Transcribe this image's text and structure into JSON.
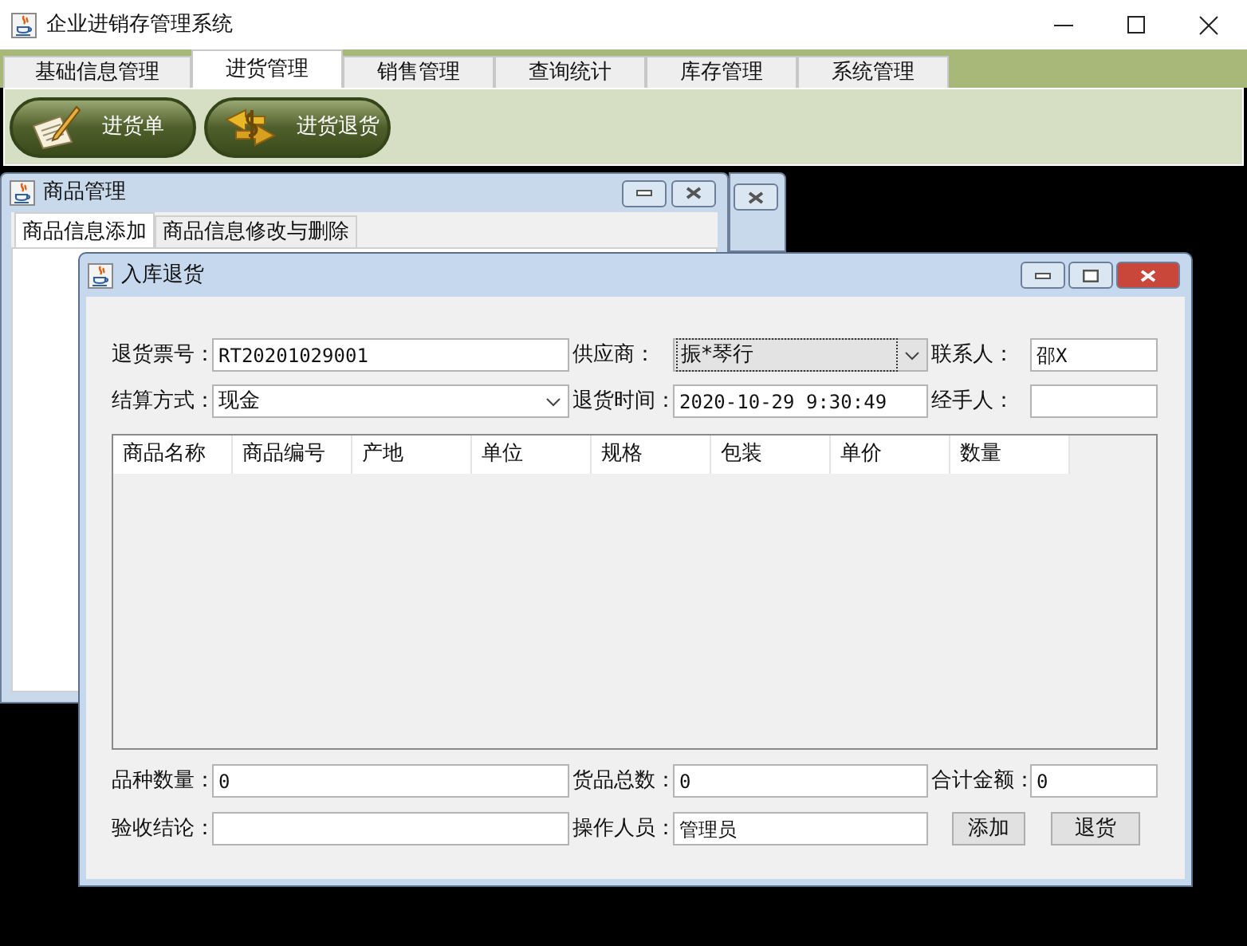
{
  "app": {
    "title": "企业进销存管理系统"
  },
  "menu_tabs": [
    {
      "label": "基础信息管理",
      "selected": false
    },
    {
      "label": "进货管理",
      "selected": true
    },
    {
      "label": "销售管理",
      "selected": false
    },
    {
      "label": "查询统计",
      "selected": false
    },
    {
      "label": "库存管理",
      "selected": false
    },
    {
      "label": "系统管理",
      "selected": false
    }
  ],
  "toolbar": [
    {
      "label": "进货单",
      "kind": "note"
    },
    {
      "label": "进货退货",
      "kind": "money"
    }
  ],
  "back_window": {
    "title": "商品管理",
    "tabs": [
      {
        "label": "商品信息添加",
        "selected": true
      },
      {
        "label": "商品信息修改与删除",
        "selected": false
      }
    ]
  },
  "dialog": {
    "title": "入库退货",
    "form_top": [
      [
        {
          "label": "退货票号：",
          "value": "RT20201029001",
          "kind": "text",
          "focused": false
        },
        {
          "label": "供应商：",
          "value": "振*琴行",
          "kind": "combo",
          "focused": true
        },
        {
          "label": "联系人：",
          "value": "邵X",
          "kind": "text",
          "focused": false
        }
      ],
      [
        {
          "label": "结算方式：",
          "value": "现金",
          "kind": "combo",
          "focused": false
        },
        {
          "label": "退货时间：",
          "value": "2020-10-29 9:30:49",
          "kind": "text",
          "focused": false
        },
        {
          "label": "经手人：",
          "kind": "text",
          "focused": false
        }
      ]
    ],
    "table": {
      "columns": [
        "商品名称",
        "商品编号",
        "产地",
        "单位",
        "规格",
        "包装",
        "单价",
        "数量"
      ]
    },
    "form_bottom": [
      [
        {
          "label": "品种数量：",
          "value": "0",
          "kind": "text",
          "focused": false
        },
        {
          "label": "货品总数：",
          "value": "0",
          "kind": "text",
          "focused": false
        },
        {
          "label": "合计金额：",
          "value": "0",
          "kind": "text",
          "focused": false
        }
      ],
      [
        {
          "label": "验收结论：",
          "kind": "text",
          "focused": false
        },
        {
          "label": "操作人员：",
          "value": "管理员",
          "kind": "text",
          "focused": false
        }
      ]
    ],
    "buttons": [
      "添加",
      "退货"
    ]
  }
}
